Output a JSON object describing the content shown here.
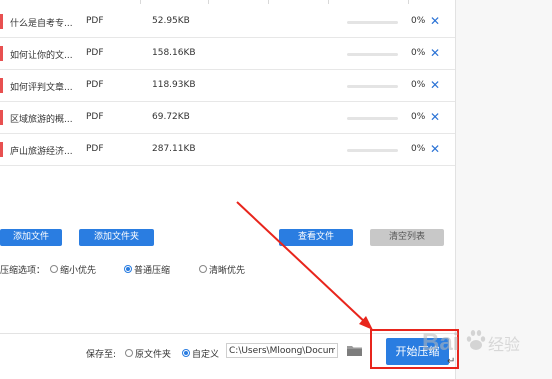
{
  "files": [
    {
      "name": "什么是自考专...",
      "type": "PDF",
      "size": "52.95KB",
      "progress_text": "0%",
      "progress": 0
    },
    {
      "name": "如何让你的文...",
      "type": "PDF",
      "size": "158.16KB",
      "progress_text": "0%",
      "progress": 0
    },
    {
      "name": "如何评判文章...",
      "type": "PDF",
      "size": "118.93KB",
      "progress_text": "0%",
      "progress": 0
    },
    {
      "name": "区域旅游的概...",
      "type": "PDF",
      "size": "69.72KB",
      "progress_text": "0%",
      "progress": 0
    },
    {
      "name": "庐山旅游经济...",
      "type": "PDF",
      "size": "287.11KB",
      "progress_text": "0%",
      "progress": 0
    }
  ],
  "delete_glyph": "✕",
  "actions": {
    "add_file": "添加文件",
    "add_folder": "添加文件夹",
    "view_file": "查看文件",
    "clear_list": "清空列表"
  },
  "compress": {
    "label": "压缩选项：",
    "options": [
      "缩小优先",
      "普通压缩",
      "清晰优先"
    ],
    "selected": "普通压缩"
  },
  "save": {
    "label": "保存至:",
    "options": [
      "原文件夹",
      "自定义"
    ],
    "selected": "自定义",
    "path": "C:\\Users\\Mloong\\Documents"
  },
  "start_button": "开始压缩",
  "cursor_glyph": "↵",
  "watermark": "Bai 经验",
  "colors": {
    "accent": "#2a7de1",
    "highlight_red": "#e8251c",
    "row_marker": "#e85050"
  }
}
